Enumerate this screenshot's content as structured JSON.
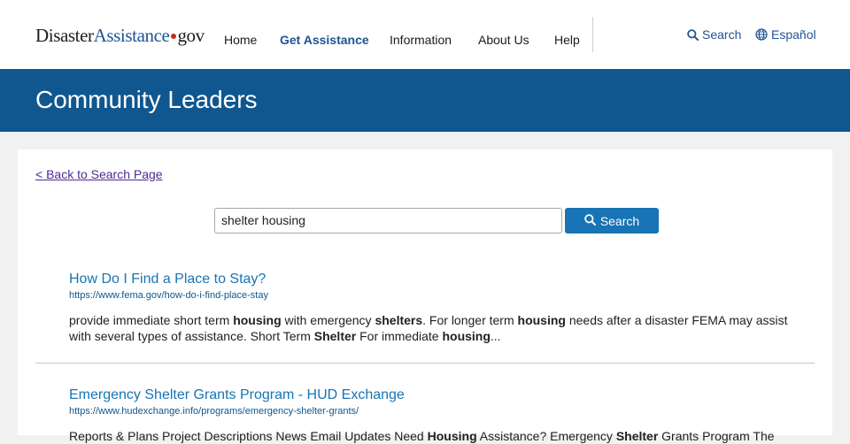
{
  "header": {
    "logo": {
      "part1": "Disaster",
      "part2": "Assistance",
      "part3": "gov"
    },
    "nav": [
      {
        "label": "Home"
      },
      {
        "label": "Get Assistance"
      },
      {
        "label": "Information"
      },
      {
        "label": "About Us"
      },
      {
        "label": "Help"
      }
    ],
    "search_label": "Search",
    "language_label": "Español"
  },
  "banner": {
    "title": "Community Leaders"
  },
  "content": {
    "back_link": "< Back to Search Page",
    "search": {
      "value": "shelter housing",
      "button_label": "Search"
    },
    "results": [
      {
        "title": "How Do I Find a Place to Stay?",
        "url": "https://www.fema.gov/how-do-i-find-place-stay",
        "snippet": [
          {
            "text": "provide immediate short term ",
            "bold": false
          },
          {
            "text": "housing",
            "bold": true
          },
          {
            "text": " with emergency ",
            "bold": false
          },
          {
            "text": "shelters",
            "bold": true
          },
          {
            "text": ".  For longer term ",
            "bold": false
          },
          {
            "text": "housing",
            "bold": true
          },
          {
            "text": " needs after a disaster FEMA may assist with several types of assistance. Short Term ",
            "bold": false
          },
          {
            "text": "Shelter",
            "bold": true
          },
          {
            "text": " For immediate ",
            "bold": false
          },
          {
            "text": "housing",
            "bold": true
          },
          {
            "text": "...",
            "bold": false
          }
        ]
      },
      {
        "title": "Emergency Shelter Grants Program - HUD Exchange",
        "url": "https://www.hudexchange.info/programs/emergency-shelter-grants/",
        "snippet": [
          {
            "text": "Reports & Plans Project Descriptions News Email Updates Need ",
            "bold": false
          },
          {
            "text": "Housing",
            "bold": true
          },
          {
            "text": " Assistance? Emergency ",
            "bold": false
          },
          {
            "text": "Shelter",
            "bold": true
          },
          {
            "text": " Grants Program The",
            "bold": false
          }
        ]
      }
    ]
  },
  "colors": {
    "banner": "#0f578e",
    "link": "#1874b4",
    "button": "#1874b4",
    "visited_link": "#4c2c92",
    "logo_dot": "#c52a1a"
  },
  "icons": [
    "search-icon",
    "globe-icon"
  ]
}
